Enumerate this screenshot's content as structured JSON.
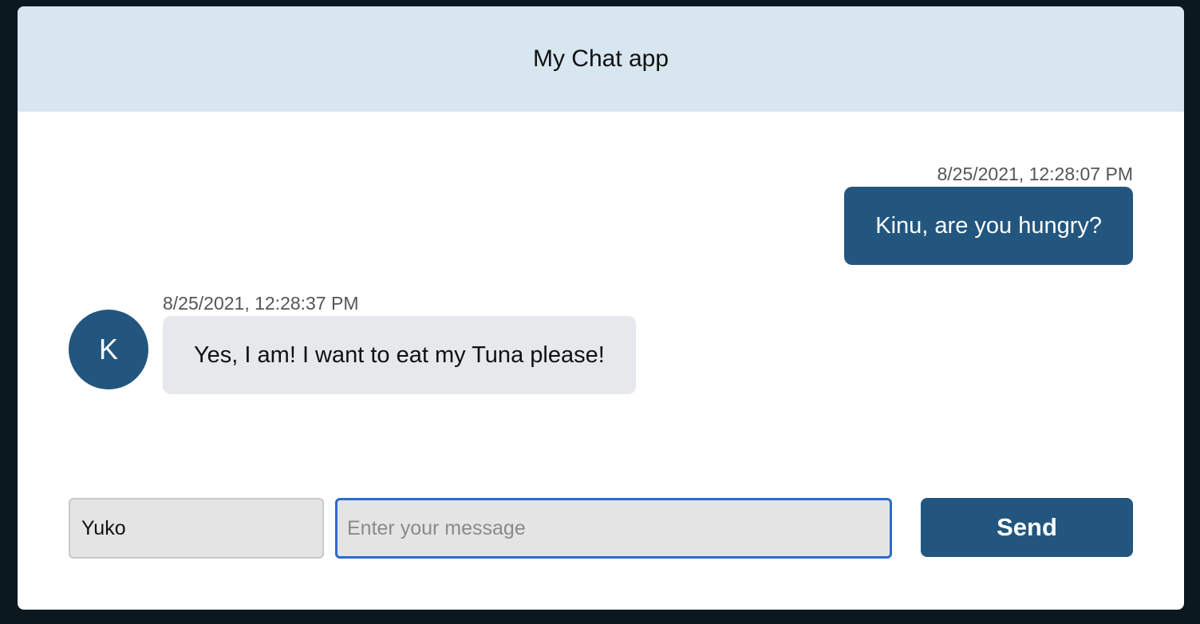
{
  "header": {
    "title": "My Chat app"
  },
  "messages": [
    {
      "direction": "outgoing",
      "timestamp": "8/25/2021, 12:28:07 PM",
      "text": "Kinu, are you hungry?"
    },
    {
      "direction": "incoming",
      "avatar_initial": "K",
      "timestamp": "8/25/2021, 12:28:37 PM",
      "text": "Yes, I am! I want to eat my Tuna please!"
    }
  ],
  "composer": {
    "name_value": "Yuko",
    "message_value": "",
    "message_placeholder": "Enter your message",
    "send_label": "Send"
  },
  "colors": {
    "header_bg": "#d8e6f0",
    "accent": "#23567f",
    "incoming_bubble": "#e6e8ec",
    "focus_border": "#2c6ad0"
  }
}
